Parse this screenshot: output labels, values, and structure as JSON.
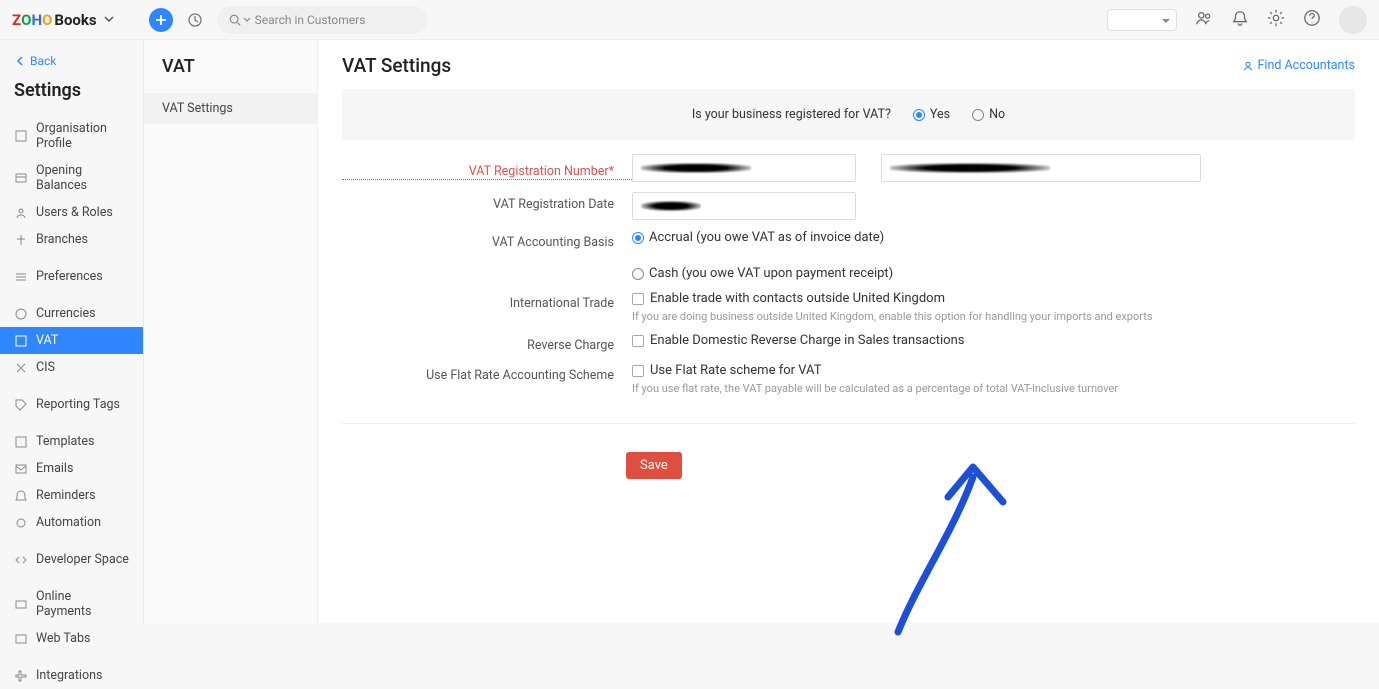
{
  "brand": {
    "books": "Books"
  },
  "topbar": {
    "search_placeholder": "Search in Customers"
  },
  "sidebar": {
    "back": "Back",
    "title": "Settings",
    "items": [
      {
        "label": "Organisation Profile"
      },
      {
        "label": "Opening Balances"
      },
      {
        "label": "Users & Roles"
      },
      {
        "label": "Branches"
      },
      {
        "label": "Preferences"
      },
      {
        "label": "Currencies"
      },
      {
        "label": "VAT"
      },
      {
        "label": "CIS"
      },
      {
        "label": "Reporting Tags"
      },
      {
        "label": "Templates"
      },
      {
        "label": "Emails"
      },
      {
        "label": "Reminders"
      },
      {
        "label": "Automation"
      },
      {
        "label": "Developer Space"
      },
      {
        "label": "Online Payments"
      },
      {
        "label": "Web Tabs"
      },
      {
        "label": "Integrations"
      }
    ]
  },
  "subnav": {
    "title": "VAT",
    "item": "VAT Settings"
  },
  "page": {
    "title": "VAT Settings",
    "find_accountants": "Find Accountants"
  },
  "form": {
    "registered_q": "Is your business registered for VAT?",
    "yes": "Yes",
    "no": "No",
    "vat_reg_num_label": "VAT Registration Number*",
    "vat_reg_date_label": "VAT Registration Date",
    "vat_basis_label": "VAT Accounting Basis",
    "basis_accrual": "Accrual (you owe VAT as of invoice date)",
    "basis_cash": "Cash (you owe VAT upon payment receipt)",
    "intl_trade_label": "International Trade",
    "intl_trade_opt": "Enable trade with contacts outside United Kingdom",
    "intl_trade_hint": "If you are doing business outside United Kingdom, enable this option for handling your imports and exports",
    "reverse_label": "Reverse Charge",
    "reverse_opt": "Enable Domestic Reverse Charge in Sales transactions",
    "flat_label": "Use Flat Rate Accounting Scheme",
    "flat_opt": "Use Flat Rate scheme for VAT",
    "flat_hint": "If you use flat rate, the VAT payable will be calculated as a percentage of total VAT-inclusive turnover",
    "save": "Save"
  }
}
